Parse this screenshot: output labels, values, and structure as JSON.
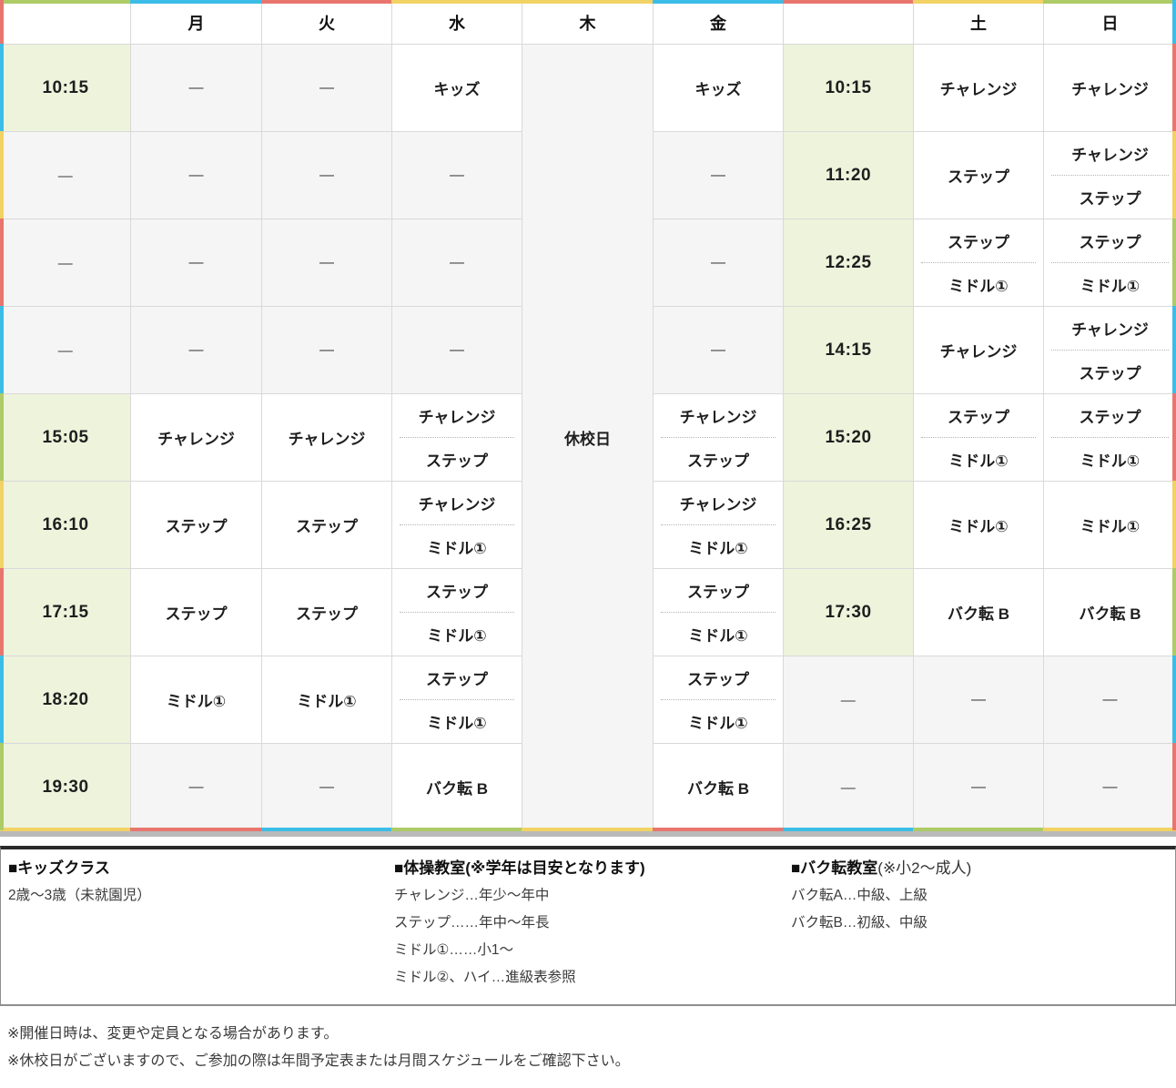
{
  "palette": {
    "cyan": "#3bbde8",
    "red": "#e8766e",
    "yellow": "#f2d264",
    "green": "#adcb66"
  },
  "header": {
    "day_labels": {
      "mon": "月",
      "tue": "火",
      "wed": "水",
      "thu": "木",
      "fri": "金",
      "sat": "土",
      "sun": "日"
    }
  },
  "closed_cell": "休校日",
  "rows": [
    {
      "left_time": "10:15",
      "mon": [
        "—"
      ],
      "tue": [
        "—"
      ],
      "wed": [
        "キッズ"
      ],
      "fri": [
        "キッズ"
      ],
      "right_time": "10:15",
      "sat": [
        "チャレンジ"
      ],
      "sun": [
        "チャレンジ"
      ]
    },
    {
      "left_time": "—",
      "mon": [
        "—"
      ],
      "tue": [
        "—"
      ],
      "wed": [
        "—"
      ],
      "fri": [
        "—"
      ],
      "right_time": "11:20",
      "sat": [
        "ステップ"
      ],
      "sun": [
        "チャレンジ",
        "ステップ"
      ]
    },
    {
      "left_time": "—",
      "mon": [
        "—"
      ],
      "tue": [
        "—"
      ],
      "wed": [
        "—"
      ],
      "fri": [
        "—"
      ],
      "right_time": "12:25",
      "sat": [
        "ステップ",
        "ミドル①"
      ],
      "sun": [
        "ステップ",
        "ミドル①"
      ]
    },
    {
      "left_time": "—",
      "mon": [
        "—"
      ],
      "tue": [
        "—"
      ],
      "wed": [
        "—"
      ],
      "fri": [
        "—"
      ],
      "right_time": "14:15",
      "sat": [
        "チャレンジ"
      ],
      "sun": [
        "チャレンジ",
        "ステップ"
      ]
    },
    {
      "left_time": "15:05",
      "mon": [
        "チャレンジ"
      ],
      "tue": [
        "チャレンジ"
      ],
      "wed": [
        "チャレンジ",
        "ステップ"
      ],
      "fri": [
        "チャレンジ",
        "ステップ"
      ],
      "right_time": "15:20",
      "sat": [
        "ステップ",
        "ミドル①"
      ],
      "sun": [
        "ステップ",
        "ミドル①"
      ]
    },
    {
      "left_time": "16:10",
      "mon": [
        "ステップ"
      ],
      "tue": [
        "ステップ"
      ],
      "wed": [
        "チャレンジ",
        "ミドル①"
      ],
      "fri": [
        "チャレンジ",
        "ミドル①"
      ],
      "right_time": "16:25",
      "sat": [
        "ミドル①"
      ],
      "sun": [
        "ミドル①"
      ]
    },
    {
      "left_time": "17:15",
      "mon": [
        "ステップ"
      ],
      "tue": [
        "ステップ"
      ],
      "wed": [
        "ステップ",
        "ミドル①"
      ],
      "fri": [
        "ステップ",
        "ミドル①"
      ],
      "right_time": "17:30",
      "sat": [
        "バク転 B"
      ],
      "sun": [
        "バク転 B"
      ]
    },
    {
      "left_time": "18:20",
      "mon": [
        "ミドル①"
      ],
      "tue": [
        "ミドル①"
      ],
      "wed": [
        "ステップ",
        "ミドル①"
      ],
      "fri": [
        "ステップ",
        "ミドル①"
      ],
      "right_time": "—",
      "sat": [
        "—"
      ],
      "sun": [
        "—"
      ]
    },
    {
      "left_time": "19:30",
      "mon": [
        "—"
      ],
      "tue": [
        "—"
      ],
      "wed": [
        "バク転 B"
      ],
      "fri": [
        "バク転 B"
      ],
      "right_time": "—",
      "sat": [
        "—"
      ],
      "sun": [
        "—"
      ]
    }
  ],
  "legend": {
    "sections": [
      {
        "title": "■キッズクラス",
        "note": "",
        "lines": [
          "2歳〜3歳（未就園児）"
        ]
      },
      {
        "title": "■体操教室(※学年は目安となります)",
        "note": "",
        "lines": [
          "チャレンジ…年少〜年中",
          "ステップ……年中〜年長",
          "ミドル①……小1〜",
          "ミドル②、ハイ…進級表参照"
        ]
      },
      {
        "title": "■バク転教室",
        "note": "(※小2〜成人)",
        "lines": [
          "バク転A…中級、上級",
          "バク転B…初級、中級"
        ]
      }
    ]
  },
  "footnotes": [
    "※開催日時は、変更や定員となる場合があります。",
    "※休校日がございますので、ご参加の際は年間予定表または月間スケジュールをご確認下さい。"
  ]
}
